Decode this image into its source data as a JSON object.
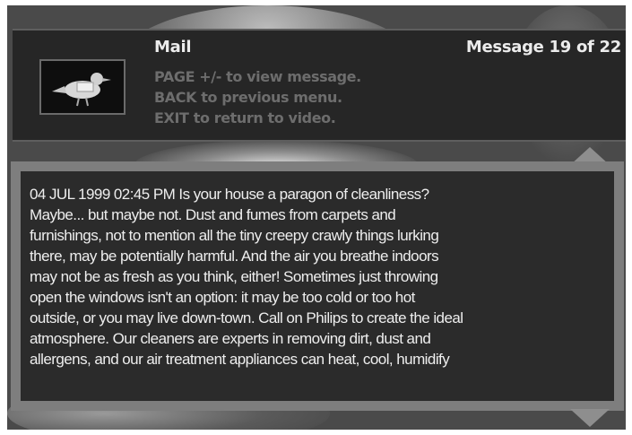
{
  "header": {
    "title": "Mail",
    "counter": "Message 19 of 22",
    "help_lines": [
      "PAGE +/- to view message.",
      "BACK to previous menu.",
      "EXIT to return to video."
    ],
    "thumbnail_icon": "mail-bird-icon"
  },
  "message": {
    "text": "04 JUL 1999 02:45 PM Is your house a paragon  of cleanliness?\nMaybe... but maybe not. Dust and fumes from carpets and\nfurnishings,  not to mention all the tiny creepy crawly things lurking\nthere, may be potentially harmful. And the air you breathe indoors\nmay not be as fresh as you think, either! Sometimes just throwing\nopen the windows isn't an option: it may be too cold or too hot\noutside, or you may live down-town. Call on Philips to create the ideal\natmosphere. Our cleaners are experts in removing dirt, dust and\nallergens, and our air treatment appliances can heat, cool, humidify"
  },
  "scroll": {
    "up_icon": "scroll-up-arrow-icon",
    "down_icon": "scroll-down-arrow-icon"
  },
  "colors": {
    "panel": "#262626",
    "frame": "#7e7e7e",
    "text": "#eeeeee",
    "help_text": "#6d6d6d"
  }
}
